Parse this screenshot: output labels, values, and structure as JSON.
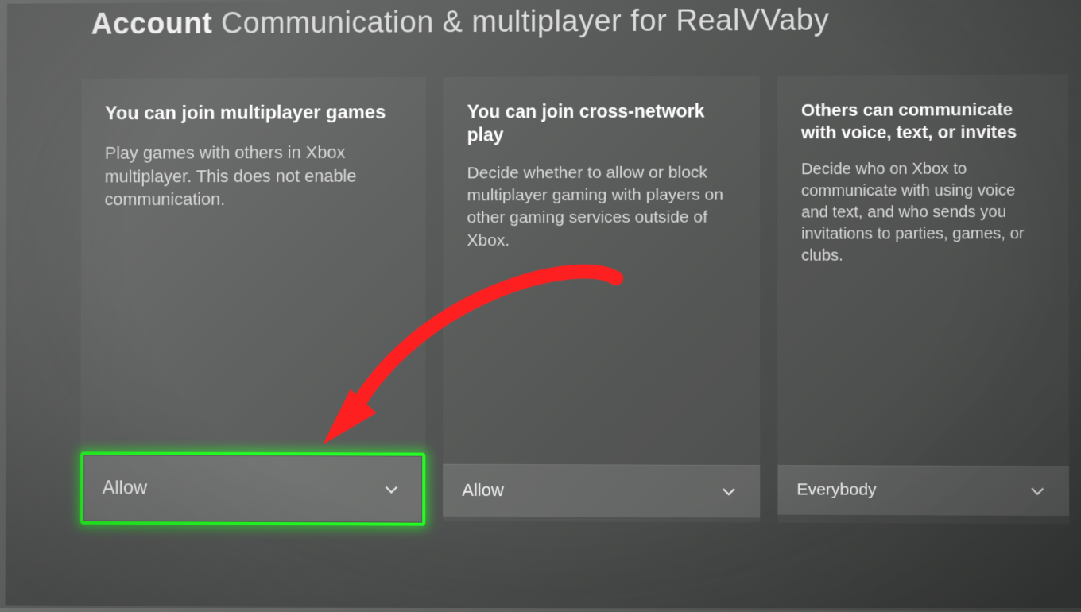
{
  "accent": {
    "focus": "#1eff1e",
    "annotation": "#ff1a1a"
  },
  "header": {
    "strong": "Account",
    "rest": "Communication & multiplayer for RealVVaby"
  },
  "cards": [
    {
      "title": "You can join multiplayer games",
      "desc": "Play games with others in Xbox multiplayer. This does not enable communication.",
      "selected": "Allow"
    },
    {
      "title": "You can join cross-network play",
      "desc": "Decide whether to allow or block multiplayer gaming with players on other gaming services outside of Xbox.",
      "selected": "Allow"
    },
    {
      "title": "Others can communicate with voice, text, or invites",
      "desc": "Decide who on Xbox to communicate with using voice and text, and who sends you invitations to parties, games, or clubs.",
      "selected": "Everybody"
    }
  ]
}
